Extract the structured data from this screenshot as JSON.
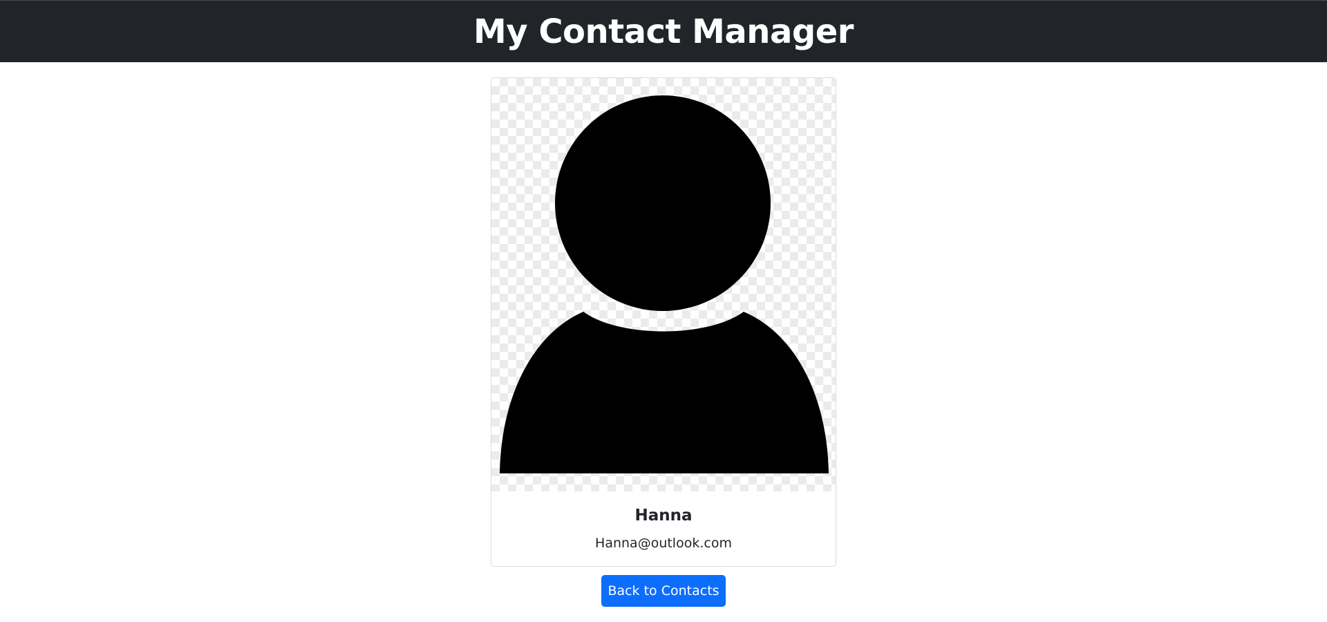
{
  "header": {
    "title": "My Contact Manager"
  },
  "contact": {
    "name": "Hanna",
    "email": "Hanna@outlook.com",
    "avatar_icon": "person-silhouette-icon"
  },
  "actions": {
    "back_label": "Back to Contacts"
  },
  "colors": {
    "navbar": "#212529",
    "button": "#0d6efd"
  }
}
